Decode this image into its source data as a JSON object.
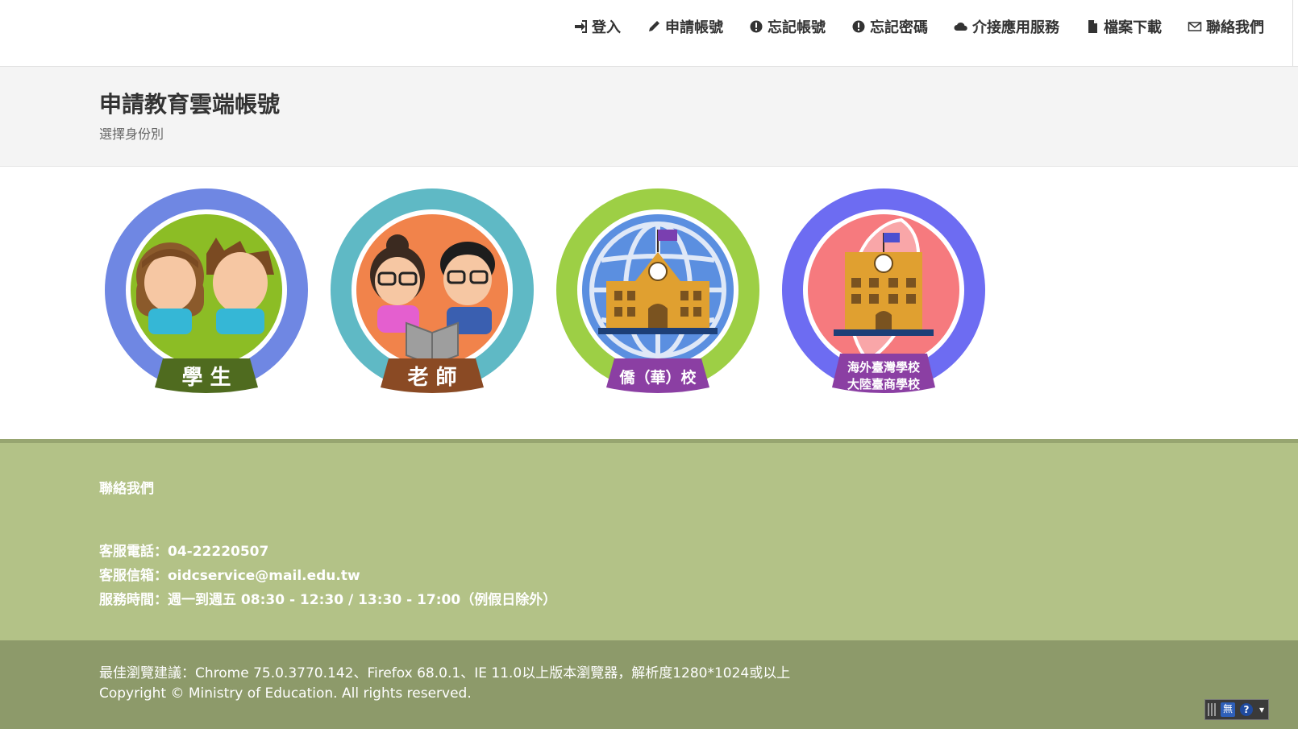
{
  "nav": {
    "items": [
      {
        "label": "登入",
        "icon": "sign-in-icon"
      },
      {
        "label": "申請帳號",
        "icon": "pencil-icon"
      },
      {
        "label": "忘記帳號",
        "icon": "exclamation-circle-icon"
      },
      {
        "label": "忘記密碼",
        "icon": "exclamation-circle-icon"
      },
      {
        "label": "介接應用服務",
        "icon": "cloud-icon"
      },
      {
        "label": "檔案下載",
        "icon": "file-icon"
      },
      {
        "label": "聯絡我們",
        "icon": "envelope-icon"
      }
    ]
  },
  "header": {
    "title": "申請教育雲端帳號",
    "subtitle": "選擇身份別"
  },
  "roles": [
    {
      "label": "學 生",
      "ring_color": "#6f87e3",
      "bg_color": "#8cbd25",
      "ribbon_color": "#4f6b1f"
    },
    {
      "label": "老 師",
      "ring_color": "#5fb9c5",
      "bg_color": "#f1834b",
      "ribbon_color": "#8a4a24"
    },
    {
      "label": "僑（華）校",
      "ring_color": "#9dcf45",
      "bg_color": "#5b8fe0",
      "ribbon_color": "#8b3fa3"
    },
    {
      "label_lines": [
        "海外臺灣學校",
        "大陸臺商學校"
      ],
      "ring_color": "#6d6cf2",
      "bg_color": "#f67a7e",
      "ribbon_color": "#8b3fa3"
    }
  ],
  "footer": {
    "contact_title": "聯絡我們",
    "phone": "客服電話：04-22220507",
    "email": "客服信箱：oidcservice@mail.edu.tw",
    "hours": "服務時間：週一到週五 08:30 - 12:30 / 13:30 - 17:00（例假日除外）",
    "browser_note": "最佳瀏覽建議：Chrome 75.0.3770.142、Firefox 68.0.1、IE 11.0以上版本瀏覽器，解析度1280*1024或以上",
    "copyright": "Copyright © Ministry of Education. All rights reserved."
  },
  "ime": {
    "mode": "無",
    "help": "?"
  },
  "colors": {
    "footer_top": "#b3c287",
    "footer_bottom": "#8d9a6a",
    "header_band": "#f4f4f4"
  }
}
